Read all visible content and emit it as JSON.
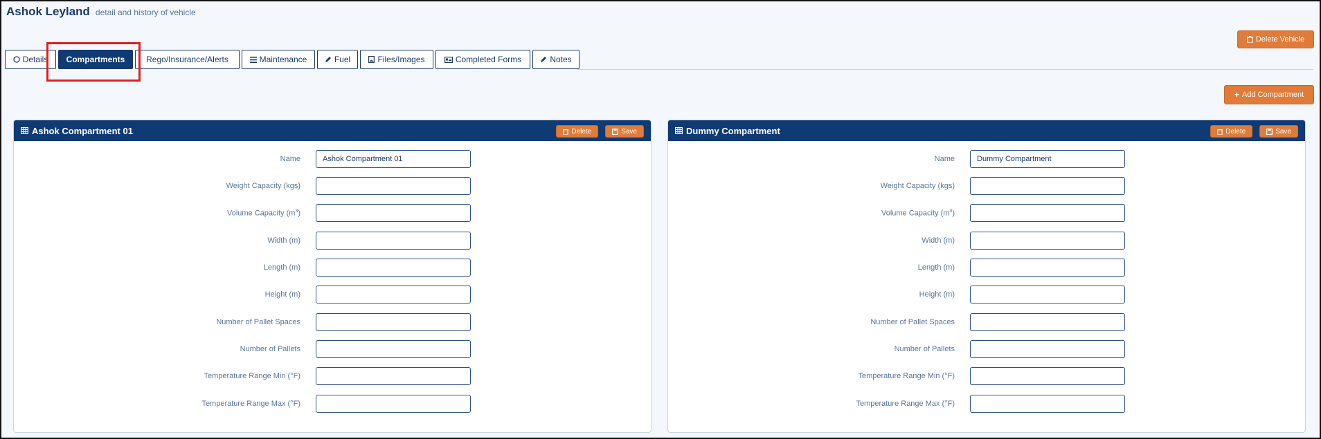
{
  "header": {
    "title": "Ashok Leyland",
    "subtitle": "detail and history of vehicle"
  },
  "toolbar": {
    "delete_vehicle_label": "Delete Vehicle",
    "add_compartment_label": "Add Compartment"
  },
  "tabs": [
    {
      "label": "Details",
      "icon": "circle-icon"
    },
    {
      "label": "Compartments",
      "active": true
    },
    {
      "label": "Rego/Insurance/Alerts"
    },
    {
      "label": "Maintenance",
      "icon": "bars-icon"
    },
    {
      "label": "Fuel",
      "icon": "pencil-icon"
    },
    {
      "label": "Files/Images",
      "icon": "image-file-icon"
    },
    {
      "label": "Completed Forms",
      "icon": "id-card-icon"
    },
    {
      "label": "Notes",
      "icon": "pencil-icon"
    }
  ],
  "field_labels": {
    "name": "Name",
    "weight": "Weight Capacity (kgs)",
    "volume": "Volume Capacity (m",
    "volume_sup": "3",
    "volume_close": ")",
    "width": "Width (m)",
    "length": "Length (m)",
    "height": "Height (m)",
    "pallet_spaces": "Number of Pallet Spaces",
    "pallets": "Number of Pallets",
    "temp_min": "Temperature Range Min (°F)",
    "temp_max": "Temperature Range Max (°F)"
  },
  "compartments": [
    {
      "title": "Ashok Compartment 01",
      "delete_label": "Delete",
      "save_label": "Save",
      "values": {
        "name": "Ashok Compartment 01",
        "weight": "",
        "volume": "",
        "width": "",
        "length": "",
        "height": "",
        "pallet_spaces": "",
        "pallets": "",
        "temp_min": "",
        "temp_max": ""
      }
    },
    {
      "title": "Dummy Compartment",
      "delete_label": "Delete",
      "save_label": "Save",
      "values": {
        "name": "Dummy Compartment",
        "weight": "",
        "volume": "",
        "width": "",
        "length": "",
        "height": "",
        "pallet_spaces": "",
        "pallets": "",
        "temp_min": "",
        "temp_max": ""
      }
    }
  ],
  "colors": {
    "navy": "#103a74",
    "orange": "#e07b39",
    "highlight": "#e01e1e"
  }
}
